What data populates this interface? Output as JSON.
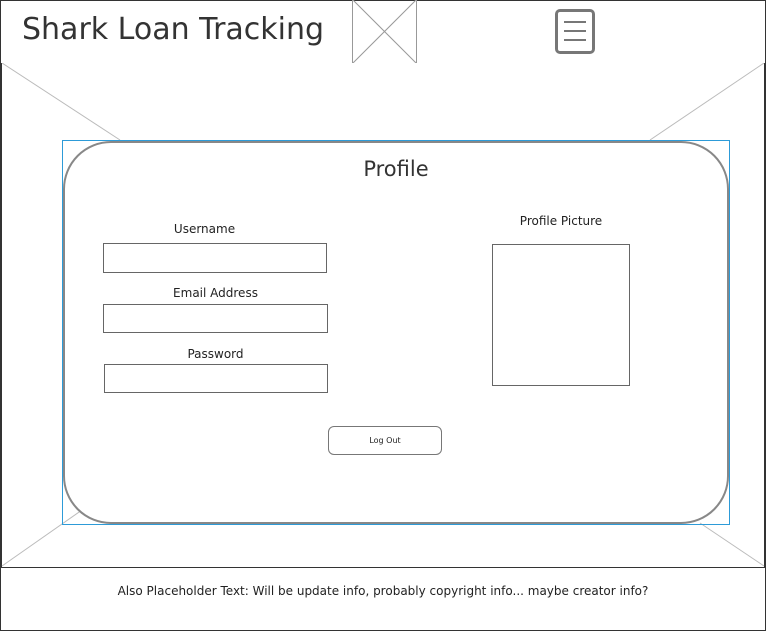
{
  "header": {
    "title": "Shark Loan Tracking",
    "logo": "image-placeholder",
    "menu_icon": "hamburger-menu-icon"
  },
  "profile": {
    "title": "Profile",
    "username_label": "Username",
    "username_value": "",
    "email_label": "Email Address",
    "email_value": "",
    "password_label": "Password",
    "password_value": "",
    "picture_label": "Profile Picture",
    "logout_label": "Log Out"
  },
  "footer": {
    "text": "Also Placeholder Text: Will be update info, probably copyright info... maybe creator info?"
  },
  "colors": {
    "border": "#333333",
    "selection": "#2d9bd8",
    "placeholder_lines": "#bbbbbb"
  }
}
